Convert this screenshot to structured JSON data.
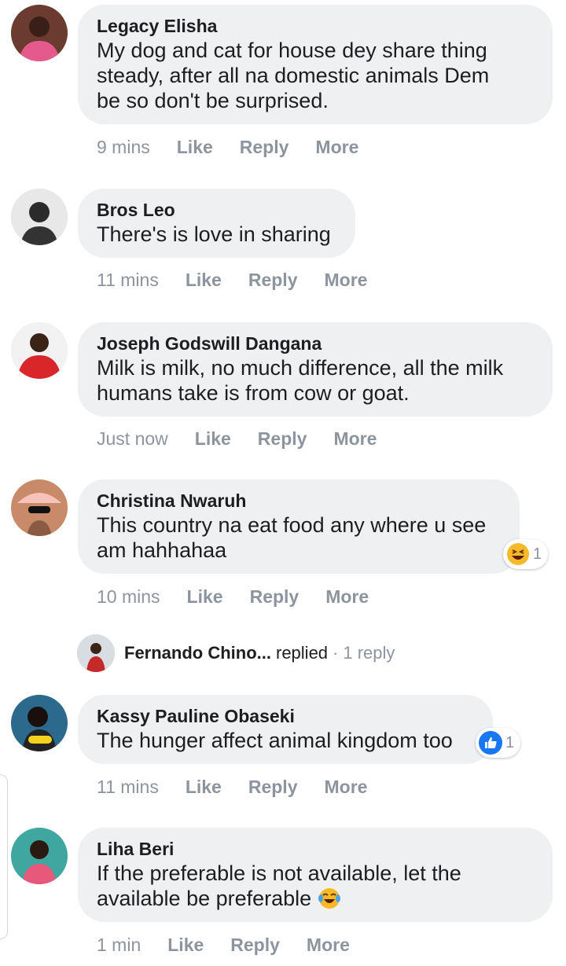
{
  "comments": [
    {
      "author": "Legacy Elisha",
      "lines": [
        "My dog and cat for house dey share thing",
        "steady, after all na domestic animals Dem",
        "be so don't be surprised."
      ],
      "time": "9 mins",
      "like": "Like",
      "reply": "Reply",
      "more": "More"
    },
    {
      "author": "Bros Leo",
      "lines": [
        "There's is love in sharing"
      ],
      "time": "11 mins",
      "like": "Like",
      "reply": "Reply",
      "more": "More"
    },
    {
      "author": "Joseph Godswill Dangana",
      "lines": [
        "Milk is milk, no much difference, all the milk",
        "humans take is from cow or goat."
      ],
      "time": "Just now",
      "like": "Like",
      "reply": "Reply",
      "more": "More"
    },
    {
      "author": "Christina Nwaruh",
      "lines": [
        "This country na eat food any where u see",
        "am hahhahaa"
      ],
      "time": "10 mins",
      "like": "Like",
      "reply": "Reply",
      "more": "More",
      "reaction": {
        "icon": "laughing-emoji-icon",
        "count": "1"
      }
    },
    {
      "author": "Kassy Pauline Obaseki",
      "lines": [
        "The hunger affect animal kingdom too"
      ],
      "time": "11 mins",
      "like": "Like",
      "reply": "Reply",
      "more": "More",
      "reaction": {
        "icon": "thumbs-up-icon",
        "count": "1"
      }
    },
    {
      "author": "Liha Beri",
      "lines": [
        "If the preferable is not available, let the",
        "available be preferable"
      ],
      "time": "1 min",
      "like": "Like",
      "reply": "Reply",
      "more": "More",
      "trailing_icon": "tears-of-joy-emoji-icon"
    }
  ],
  "reply_summary": {
    "name": "Fernando Chino...",
    "verb": "replied",
    "separator": "·",
    "count": "1 reply"
  },
  "colors": {
    "bubble": "#eff0f2",
    "meta_text": "#8d949e",
    "like_blue": "#1877f2",
    "emoji_yellow": "#f7b928"
  }
}
